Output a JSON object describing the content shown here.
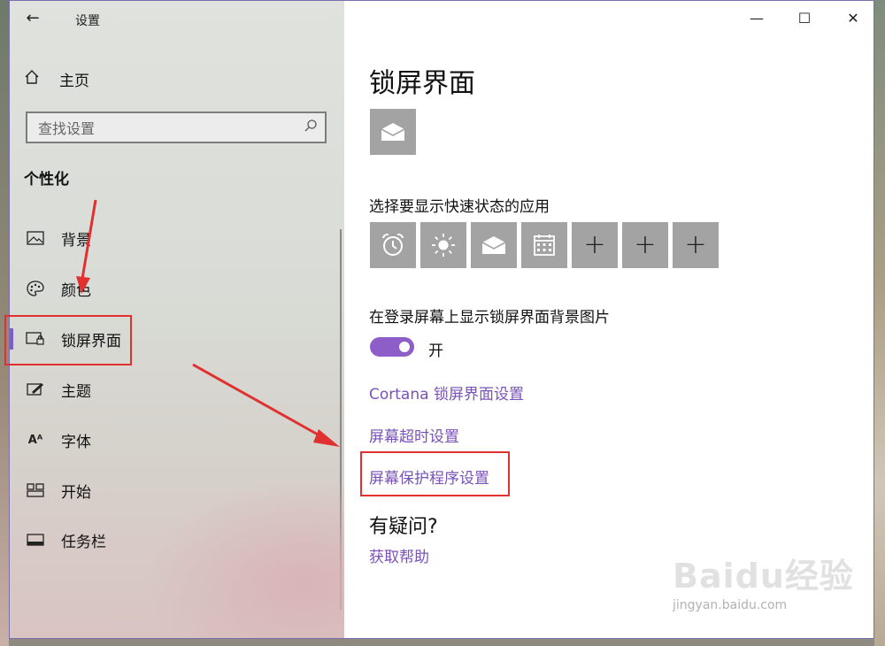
{
  "window": {
    "title": "设置"
  },
  "sidebar": {
    "home_label": "主页",
    "search_placeholder": "查找设置",
    "section": "个性化",
    "items": [
      {
        "label": "背景",
        "icon": "image-icon"
      },
      {
        "label": "颜色",
        "icon": "palette-icon"
      },
      {
        "label": "锁屏界面",
        "icon": "lock-screen-icon",
        "active": true
      },
      {
        "label": "主题",
        "icon": "theme-icon"
      },
      {
        "label": "字体",
        "icon": "font-icon"
      },
      {
        "label": "开始",
        "icon": "start-icon"
      },
      {
        "label": "任务栏",
        "icon": "taskbar-icon"
      }
    ]
  },
  "main": {
    "title": "锁屏界面",
    "quick_status_label": "选择要显示快速状态的应用",
    "quick_status_apps": [
      "alarm-icon",
      "weather-icon",
      "mail-icon",
      "calendar-icon",
      "plus-icon",
      "plus-icon",
      "plus-icon"
    ],
    "show_background_label": "在登录屏幕上显示锁屏界面背景图片",
    "toggle_state": "开",
    "links": {
      "cortana": "Cortana 锁屏界面设置",
      "timeout": "屏幕超时设置",
      "screensaver": "屏幕保护程序设置"
    },
    "help_heading": "有疑问?",
    "help_link": "获取帮助"
  },
  "watermark": {
    "logo": "Baidu经验",
    "url": "jingyan.baidu.com"
  },
  "colors": {
    "accent": "#8d5ec8",
    "link": "#7952b7",
    "annotation": "#e03030",
    "tile": "#a3a3a3"
  }
}
